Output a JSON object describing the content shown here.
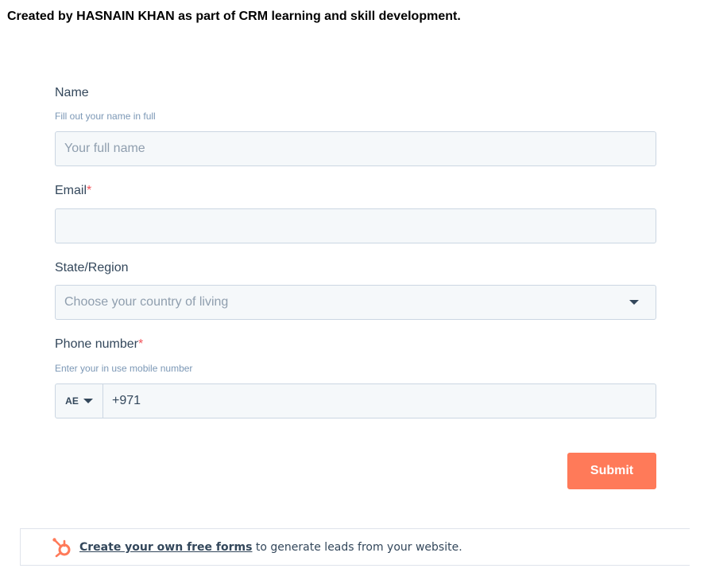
{
  "intro_text": "Created by HASNAIN KHAN as part of CRM learning and skill development.",
  "form": {
    "name": {
      "label": "Name",
      "help": "Fill out your name in full",
      "placeholder": "Your full name",
      "value": ""
    },
    "email": {
      "label": "Email",
      "required_mark": "*",
      "value": ""
    },
    "state": {
      "label": "State/Region",
      "placeholder": "Choose your country of living"
    },
    "phone": {
      "label": "Phone number",
      "required_mark": "*",
      "help": "Enter your in use mobile number",
      "country_code": "AE",
      "value": "+971"
    },
    "submit_label": "Submit"
  },
  "footer": {
    "link_text": "Create your own free forms",
    "suffix_text": " to generate leads from your website.",
    "logo_icon": "hubspot-sprocket-icon"
  },
  "colors": {
    "accent": "#ff7a59",
    "required": "#f2545b",
    "input_bg": "#f5f8fa",
    "input_border": "#cbd6e2",
    "label": "#33475b",
    "help": "#7c98b6"
  }
}
